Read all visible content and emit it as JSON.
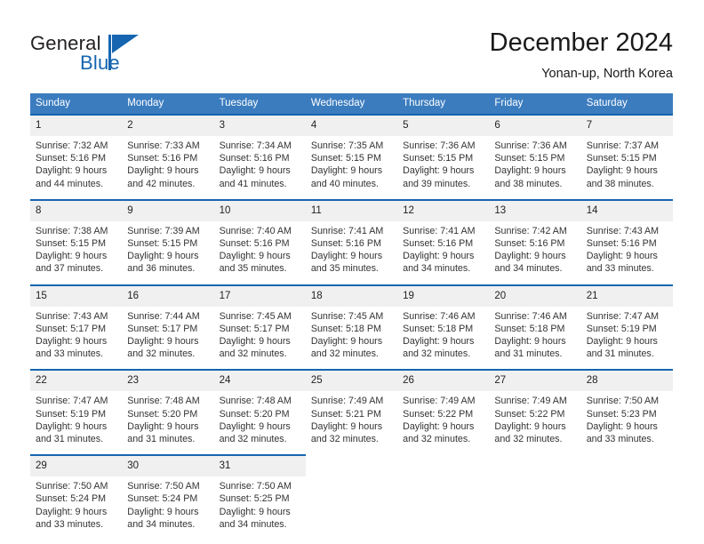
{
  "brand": {
    "name_part1": "General",
    "name_part2": "Blue",
    "logo_color": "#1565b0"
  },
  "header": {
    "title": "December 2024",
    "subtitle": "Yonan-up, North Korea"
  },
  "calendar": {
    "accent_color": "#3b7cbf",
    "row_border_color": "#1565b0",
    "daynum_bg": "#f0f0f0",
    "weekday_headers": [
      "Sunday",
      "Monday",
      "Tuesday",
      "Wednesday",
      "Thursday",
      "Friday",
      "Saturday"
    ],
    "weeks": [
      [
        {
          "day": "1",
          "sunrise": "Sunrise: 7:32 AM",
          "sunset": "Sunset: 5:16 PM",
          "daylight_line1": "Daylight: 9 hours",
          "daylight_line2": "and 44 minutes."
        },
        {
          "day": "2",
          "sunrise": "Sunrise: 7:33 AM",
          "sunset": "Sunset: 5:16 PM",
          "daylight_line1": "Daylight: 9 hours",
          "daylight_line2": "and 42 minutes."
        },
        {
          "day": "3",
          "sunrise": "Sunrise: 7:34 AM",
          "sunset": "Sunset: 5:16 PM",
          "daylight_line1": "Daylight: 9 hours",
          "daylight_line2": "and 41 minutes."
        },
        {
          "day": "4",
          "sunrise": "Sunrise: 7:35 AM",
          "sunset": "Sunset: 5:15 PM",
          "daylight_line1": "Daylight: 9 hours",
          "daylight_line2": "and 40 minutes."
        },
        {
          "day": "5",
          "sunrise": "Sunrise: 7:36 AM",
          "sunset": "Sunset: 5:15 PM",
          "daylight_line1": "Daylight: 9 hours",
          "daylight_line2": "and 39 minutes."
        },
        {
          "day": "6",
          "sunrise": "Sunrise: 7:36 AM",
          "sunset": "Sunset: 5:15 PM",
          "daylight_line1": "Daylight: 9 hours",
          "daylight_line2": "and 38 minutes."
        },
        {
          "day": "7",
          "sunrise": "Sunrise: 7:37 AM",
          "sunset": "Sunset: 5:15 PM",
          "daylight_line1": "Daylight: 9 hours",
          "daylight_line2": "and 38 minutes."
        }
      ],
      [
        {
          "day": "8",
          "sunrise": "Sunrise: 7:38 AM",
          "sunset": "Sunset: 5:15 PM",
          "daylight_line1": "Daylight: 9 hours",
          "daylight_line2": "and 37 minutes."
        },
        {
          "day": "9",
          "sunrise": "Sunrise: 7:39 AM",
          "sunset": "Sunset: 5:15 PM",
          "daylight_line1": "Daylight: 9 hours",
          "daylight_line2": "and 36 minutes."
        },
        {
          "day": "10",
          "sunrise": "Sunrise: 7:40 AM",
          "sunset": "Sunset: 5:16 PM",
          "daylight_line1": "Daylight: 9 hours",
          "daylight_line2": "and 35 minutes."
        },
        {
          "day": "11",
          "sunrise": "Sunrise: 7:41 AM",
          "sunset": "Sunset: 5:16 PM",
          "daylight_line1": "Daylight: 9 hours",
          "daylight_line2": "and 35 minutes."
        },
        {
          "day": "12",
          "sunrise": "Sunrise: 7:41 AM",
          "sunset": "Sunset: 5:16 PM",
          "daylight_line1": "Daylight: 9 hours",
          "daylight_line2": "and 34 minutes."
        },
        {
          "day": "13",
          "sunrise": "Sunrise: 7:42 AM",
          "sunset": "Sunset: 5:16 PM",
          "daylight_line1": "Daylight: 9 hours",
          "daylight_line2": "and 34 minutes."
        },
        {
          "day": "14",
          "sunrise": "Sunrise: 7:43 AM",
          "sunset": "Sunset: 5:16 PM",
          "daylight_line1": "Daylight: 9 hours",
          "daylight_line2": "and 33 minutes."
        }
      ],
      [
        {
          "day": "15",
          "sunrise": "Sunrise: 7:43 AM",
          "sunset": "Sunset: 5:17 PM",
          "daylight_line1": "Daylight: 9 hours",
          "daylight_line2": "and 33 minutes."
        },
        {
          "day": "16",
          "sunrise": "Sunrise: 7:44 AM",
          "sunset": "Sunset: 5:17 PM",
          "daylight_line1": "Daylight: 9 hours",
          "daylight_line2": "and 32 minutes."
        },
        {
          "day": "17",
          "sunrise": "Sunrise: 7:45 AM",
          "sunset": "Sunset: 5:17 PM",
          "daylight_line1": "Daylight: 9 hours",
          "daylight_line2": "and 32 minutes."
        },
        {
          "day": "18",
          "sunrise": "Sunrise: 7:45 AM",
          "sunset": "Sunset: 5:18 PM",
          "daylight_line1": "Daylight: 9 hours",
          "daylight_line2": "and 32 minutes."
        },
        {
          "day": "19",
          "sunrise": "Sunrise: 7:46 AM",
          "sunset": "Sunset: 5:18 PM",
          "daylight_line1": "Daylight: 9 hours",
          "daylight_line2": "and 32 minutes."
        },
        {
          "day": "20",
          "sunrise": "Sunrise: 7:46 AM",
          "sunset": "Sunset: 5:18 PM",
          "daylight_line1": "Daylight: 9 hours",
          "daylight_line2": "and 31 minutes."
        },
        {
          "day": "21",
          "sunrise": "Sunrise: 7:47 AM",
          "sunset": "Sunset: 5:19 PM",
          "daylight_line1": "Daylight: 9 hours",
          "daylight_line2": "and 31 minutes."
        }
      ],
      [
        {
          "day": "22",
          "sunrise": "Sunrise: 7:47 AM",
          "sunset": "Sunset: 5:19 PM",
          "daylight_line1": "Daylight: 9 hours",
          "daylight_line2": "and 31 minutes."
        },
        {
          "day": "23",
          "sunrise": "Sunrise: 7:48 AM",
          "sunset": "Sunset: 5:20 PM",
          "daylight_line1": "Daylight: 9 hours",
          "daylight_line2": "and 31 minutes."
        },
        {
          "day": "24",
          "sunrise": "Sunrise: 7:48 AM",
          "sunset": "Sunset: 5:20 PM",
          "daylight_line1": "Daylight: 9 hours",
          "daylight_line2": "and 32 minutes."
        },
        {
          "day": "25",
          "sunrise": "Sunrise: 7:49 AM",
          "sunset": "Sunset: 5:21 PM",
          "daylight_line1": "Daylight: 9 hours",
          "daylight_line2": "and 32 minutes."
        },
        {
          "day": "26",
          "sunrise": "Sunrise: 7:49 AM",
          "sunset": "Sunset: 5:22 PM",
          "daylight_line1": "Daylight: 9 hours",
          "daylight_line2": "and 32 minutes."
        },
        {
          "day": "27",
          "sunrise": "Sunrise: 7:49 AM",
          "sunset": "Sunset: 5:22 PM",
          "daylight_line1": "Daylight: 9 hours",
          "daylight_line2": "and 32 minutes."
        },
        {
          "day": "28",
          "sunrise": "Sunrise: 7:50 AM",
          "sunset": "Sunset: 5:23 PM",
          "daylight_line1": "Daylight: 9 hours",
          "daylight_line2": "and 33 minutes."
        }
      ],
      [
        {
          "day": "29",
          "sunrise": "Sunrise: 7:50 AM",
          "sunset": "Sunset: 5:24 PM",
          "daylight_line1": "Daylight: 9 hours",
          "daylight_line2": "and 33 minutes."
        },
        {
          "day": "30",
          "sunrise": "Sunrise: 7:50 AM",
          "sunset": "Sunset: 5:24 PM",
          "daylight_line1": "Daylight: 9 hours",
          "daylight_line2": "and 34 minutes."
        },
        {
          "day": "31",
          "sunrise": "Sunrise: 7:50 AM",
          "sunset": "Sunset: 5:25 PM",
          "daylight_line1": "Daylight: 9 hours",
          "daylight_line2": "and 34 minutes."
        },
        {
          "day": "",
          "sunrise": "",
          "sunset": "",
          "daylight_line1": "",
          "daylight_line2": ""
        },
        {
          "day": "",
          "sunrise": "",
          "sunset": "",
          "daylight_line1": "",
          "daylight_line2": ""
        },
        {
          "day": "",
          "sunrise": "",
          "sunset": "",
          "daylight_line1": "",
          "daylight_line2": ""
        },
        {
          "day": "",
          "sunrise": "",
          "sunset": "",
          "daylight_line1": "",
          "daylight_line2": ""
        }
      ]
    ]
  }
}
